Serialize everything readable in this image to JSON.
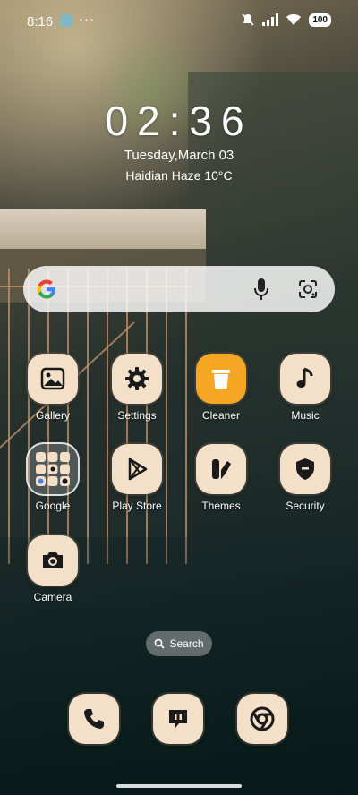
{
  "status_bar": {
    "time": "8:16",
    "overflow": "···",
    "battery": "100",
    "icons": [
      "notification-app-icon",
      "mute-icon",
      "signal-icon",
      "wifi-icon",
      "battery-icon"
    ]
  },
  "clock": {
    "time": "02:36",
    "date": "Tuesday,March 03",
    "weather": "Haidian Haze 10°C"
  },
  "search_bar": {
    "icons": [
      "google-logo-icon",
      "microphone-icon",
      "lens-icon"
    ]
  },
  "apps": [
    {
      "label": "Gallery",
      "icon": "gallery-icon"
    },
    {
      "label": "Settings",
      "icon": "gear-icon"
    },
    {
      "label": "Cleaner",
      "icon": "trash-icon"
    },
    {
      "label": "Music",
      "icon": "music-note-icon"
    },
    {
      "label": "Google",
      "icon": "google-folder-icon"
    },
    {
      "label": "Play Store",
      "icon": "play-store-icon"
    },
    {
      "label": "Themes",
      "icon": "themes-icon"
    },
    {
      "label": "Security",
      "icon": "shield-icon"
    },
    {
      "label": "Camera",
      "icon": "camera-icon"
    }
  ],
  "search_pill": {
    "label": "Search"
  },
  "dock": [
    {
      "icon": "phone-icon"
    },
    {
      "icon": "messages-icon"
    },
    {
      "icon": "chrome-icon"
    }
  ],
  "colors": {
    "icon_bg": "#f4dfc8",
    "cleaner_bg": "#f5a623",
    "icon_glyph": "#1a1a1a"
  }
}
